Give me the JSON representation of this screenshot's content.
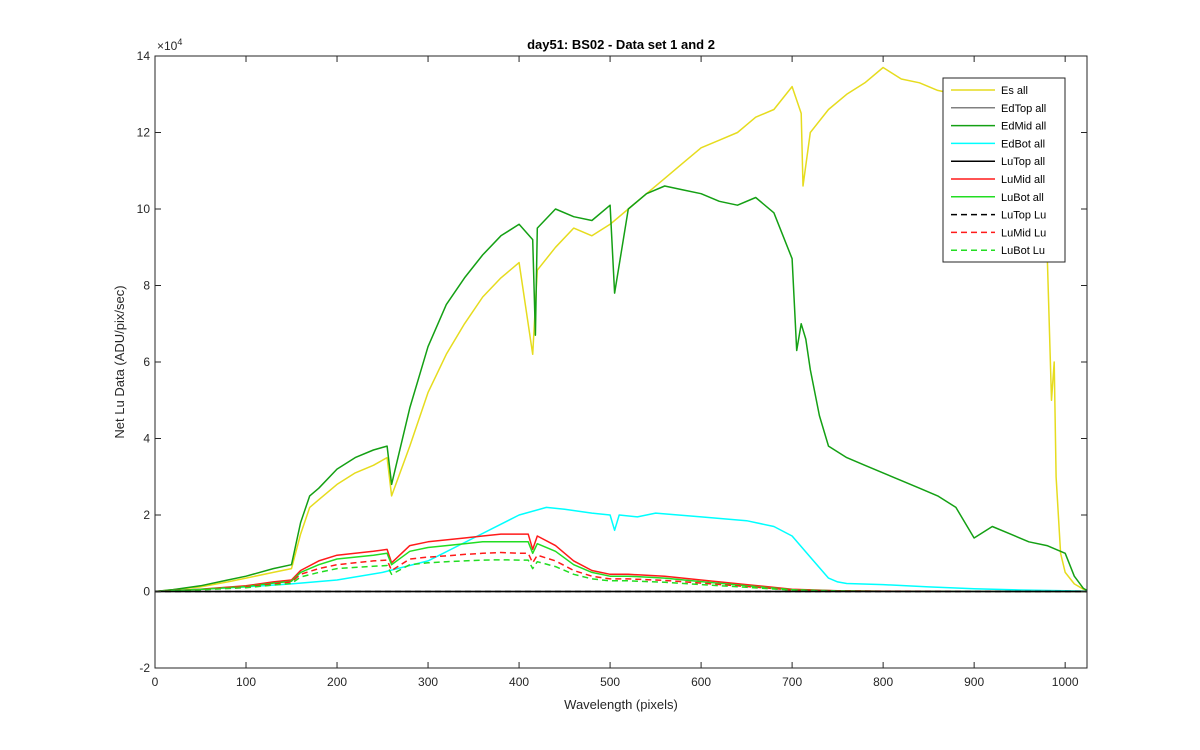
{
  "chart_data": {
    "type": "line",
    "title": "day51: BS02 - Data set 1 and 2",
    "xlabel": "Wavelength (pixels)",
    "ylabel": "Net Lu Data (ADU/pix/sec)",
    "y_exponent_label": "×10",
    "y_exponent_power": "4",
    "xlim": [
      0,
      1024
    ],
    "ylim": [
      -20000,
      140000
    ],
    "x_ticks": [
      0,
      100,
      200,
      300,
      400,
      500,
      600,
      700,
      800,
      900,
      1000
    ],
    "x_tick_labels": [
      "0",
      "100",
      "200",
      "300",
      "400",
      "500",
      "600",
      "700",
      "800",
      "900",
      "1000"
    ],
    "y_ticks": [
      -20000,
      0,
      20000,
      40000,
      60000,
      80000,
      100000,
      120000,
      140000
    ],
    "y_tick_labels": [
      "-2",
      "0",
      "2",
      "4",
      "6",
      "8",
      "10",
      "12",
      "14"
    ],
    "grid": false,
    "legend_position": "top-right",
    "series": [
      {
        "name": "Es  all",
        "color": "#e6dc1e",
        "dash": "solid",
        "x": [
          0,
          20,
          50,
          80,
          100,
          130,
          150,
          160,
          170,
          180,
          200,
          220,
          240,
          255,
          260,
          280,
          300,
          320,
          340,
          360,
          380,
          400,
          415,
          420,
          440,
          460,
          480,
          500,
          520,
          540,
          560,
          580,
          600,
          620,
          640,
          660,
          680,
          700,
          710,
          712,
          720,
          740,
          760,
          780,
          800,
          820,
          840,
          860,
          880,
          900,
          920,
          940,
          960,
          980,
          985,
          988,
          990,
          995,
          1000,
          1010,
          1020,
          1024
        ],
        "y": [
          0,
          500,
          1200,
          2500,
          3500,
          5000,
          6000,
          15000,
          22000,
          24000,
          28000,
          31000,
          33000,
          35000,
          25000,
          38000,
          52000,
          62000,
          70000,
          77000,
          82000,
          86000,
          62000,
          84000,
          90000,
          95000,
          93000,
          96000,
          100000,
          104000,
          108000,
          112000,
          116000,
          118000,
          120000,
          124000,
          126000,
          132000,
          125000,
          106000,
          120000,
          126000,
          130000,
          133000,
          137000,
          134000,
          133000,
          131000,
          130000,
          130000,
          129000,
          128000,
          126000,
          90000,
          50000,
          60000,
          30000,
          10000,
          5000,
          2000,
          600,
          300
        ]
      },
      {
        "name": "EdTop  all",
        "color": "#808080",
        "dash": "solid",
        "x": [
          0,
          1024
        ],
        "y": [
          0,
          0
        ]
      },
      {
        "name": "EdMid  all",
        "color": "#14a014",
        "dash": "solid",
        "x": [
          0,
          20,
          50,
          80,
          100,
          130,
          150,
          160,
          170,
          180,
          200,
          220,
          240,
          255,
          260,
          280,
          300,
          320,
          340,
          360,
          380,
          400,
          415,
          418,
          420,
          440,
          460,
          480,
          500,
          505,
          520,
          540,
          560,
          580,
          600,
          620,
          640,
          660,
          680,
          700,
          705,
          710,
          715,
          720,
          730,
          740,
          760,
          780,
          800,
          820,
          840,
          860,
          880,
          900,
          920,
          940,
          960,
          980,
          1000,
          1010,
          1020,
          1024
        ],
        "y": [
          0,
          500,
          1500,
          3000,
          4000,
          6000,
          7000,
          18000,
          25000,
          27000,
          32000,
          35000,
          37000,
          38000,
          28000,
          48000,
          64000,
          75000,
          82000,
          88000,
          93000,
          96000,
          92000,
          67000,
          95000,
          100000,
          98000,
          97000,
          101000,
          78000,
          100000,
          104000,
          106000,
          105000,
          104000,
          102000,
          101000,
          103000,
          99000,
          87000,
          63000,
          70000,
          66000,
          58000,
          46000,
          38000,
          35000,
          33000,
          31000,
          29000,
          27000,
          25000,
          22000,
          14000,
          17000,
          15000,
          13000,
          12000,
          10000,
          4000,
          800,
          300
        ]
      },
      {
        "name": "EdBot  all",
        "color": "#00ffff",
        "dash": "solid",
        "x": [
          0,
          50,
          100,
          150,
          200,
          250,
          300,
          350,
          400,
          430,
          450,
          480,
          500,
          505,
          510,
          530,
          550,
          600,
          650,
          680,
          700,
          720,
          740,
          750,
          760,
          800,
          850,
          900,
          950,
          1000,
          1024
        ],
        "y": [
          0,
          600,
          1200,
          2000,
          3000,
          5000,
          8000,
          14000,
          20000,
          22000,
          21500,
          20500,
          20000,
          16000,
          20000,
          19500,
          20500,
          19500,
          18500,
          17000,
          14500,
          9000,
          3500,
          2500,
          2100,
          1800,
          1200,
          700,
          400,
          200,
          100
        ]
      },
      {
        "name": "LuTop  all",
        "color": "#000000",
        "dash": "solid",
        "x": [
          0,
          1024
        ],
        "y": [
          0,
          0
        ]
      },
      {
        "name": "LuMid  all",
        "color": "#ff1a1a",
        "dash": "solid",
        "x": [
          0,
          50,
          100,
          130,
          150,
          160,
          180,
          200,
          220,
          240,
          255,
          260,
          280,
          300,
          320,
          340,
          360,
          380,
          400,
          410,
          415,
          420,
          440,
          460,
          480,
          500,
          520,
          560,
          600,
          650,
          700,
          750,
          800,
          900,
          1024
        ],
        "y": [
          0,
          600,
          1500,
          2500,
          3000,
          5500,
          8000,
          9500,
          10000,
          10500,
          11000,
          7500,
          12000,
          13000,
          13500,
          14000,
          14500,
          15000,
          15000,
          15000,
          11000,
          14500,
          12000,
          8000,
          5500,
          4500,
          4500,
          4000,
          3000,
          1800,
          600,
          200,
          100,
          50,
          0
        ]
      },
      {
        "name": "LuBot  all",
        "color": "#22dd22",
        "dash": "solid",
        "x": [
          0,
          50,
          100,
          130,
          150,
          160,
          180,
          200,
          220,
          240,
          255,
          260,
          280,
          300,
          320,
          340,
          360,
          380,
          400,
          410,
          415,
          420,
          440,
          460,
          480,
          500,
          520,
          560,
          600,
          650,
          700,
          750,
          800,
          900,
          1024
        ],
        "y": [
          0,
          550,
          1300,
          2200,
          2700,
          5000,
          7000,
          8500,
          9000,
          9500,
          10000,
          7000,
          10500,
          11500,
          12000,
          12500,
          13000,
          13000,
          13000,
          13000,
          10000,
          12500,
          10500,
          7000,
          5000,
          4000,
          4000,
          3500,
          2600,
          1500,
          500,
          150,
          80,
          40,
          0
        ]
      },
      {
        "name": "LuTop  Lu",
        "color": "#000000",
        "dash": "dashed",
        "x": [
          0,
          1024
        ],
        "y": [
          0,
          0
        ]
      },
      {
        "name": "LuMid  Lu",
        "color": "#ff1a1a",
        "dash": "dashed",
        "x": [
          0,
          50,
          100,
          130,
          150,
          160,
          180,
          200,
          220,
          240,
          255,
          260,
          280,
          300,
          320,
          340,
          360,
          380,
          400,
          410,
          415,
          420,
          440,
          460,
          480,
          500,
          520,
          560,
          600,
          650,
          700,
          750,
          800,
          900,
          1024
        ],
        "y": [
          0,
          500,
          1200,
          2000,
          2500,
          4500,
          6000,
          7000,
          7500,
          8000,
          8200,
          5500,
          8500,
          9000,
          9300,
          9700,
          10000,
          10200,
          10000,
          10000,
          7500,
          9500,
          8000,
          5500,
          4000,
          3300,
          3300,
          2900,
          2200,
          1300,
          400,
          120,
          60,
          30,
          0
        ]
      },
      {
        "name": "LuBot  Lu",
        "color": "#22dd22",
        "dash": "dashed",
        "x": [
          0,
          50,
          100,
          130,
          150,
          160,
          180,
          200,
          220,
          240,
          255,
          260,
          280,
          300,
          320,
          340,
          360,
          380,
          400,
          410,
          415,
          420,
          440,
          460,
          480,
          500,
          520,
          560,
          600,
          650,
          700,
          750,
          800,
          900,
          1024
        ],
        "y": [
          0,
          450,
          1000,
          1700,
          2100,
          3800,
          5000,
          6000,
          6300,
          6600,
          6800,
          4500,
          7000,
          7500,
          7800,
          8000,
          8200,
          8300,
          8200,
          8200,
          6000,
          7800,
          6500,
          4500,
          3300,
          2800,
          2800,
          2400,
          1800,
          1100,
          350,
          100,
          50,
          25,
          0
        ]
      }
    ]
  }
}
